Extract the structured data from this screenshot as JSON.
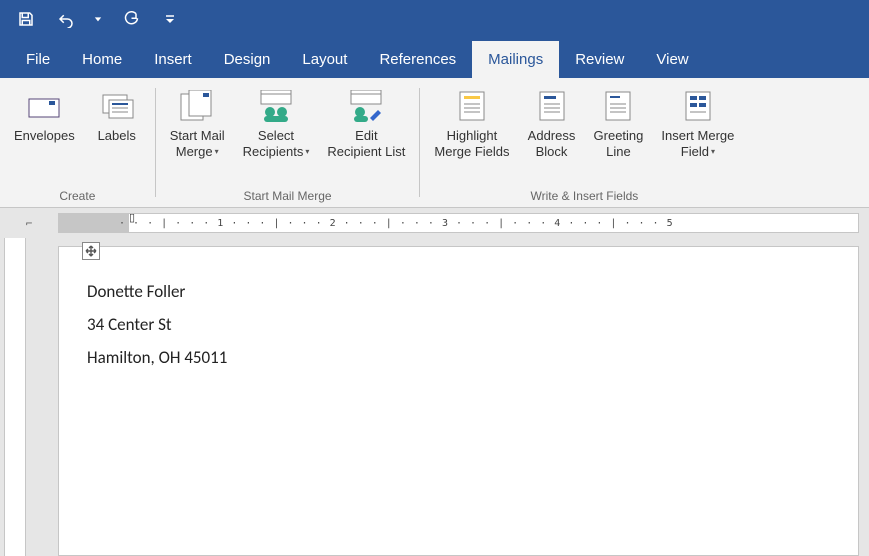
{
  "qat": {
    "save": "save-icon",
    "undo": "undo-icon",
    "redo": "redo-icon",
    "customize": "customize-icon"
  },
  "tabs": {
    "file": "File",
    "home": "Home",
    "insert": "Insert",
    "design": "Design",
    "layout": "Layout",
    "references": "References",
    "mailings": "Mailings",
    "review": "Review",
    "view": "View"
  },
  "ribbon": {
    "create": {
      "envelopes": "Envelopes",
      "labels": "Labels",
      "group_label": "Create"
    },
    "startmm": {
      "start_l1": "Start Mail",
      "start_l2": "Merge",
      "select_l1": "Select",
      "select_l2": "Recipients",
      "edit_l1": "Edit",
      "edit_l2": "Recipient List",
      "group_label": "Start Mail Merge"
    },
    "write": {
      "hl_l1": "Highlight",
      "hl_l2": "Merge Fields",
      "ab_l1": "Address",
      "ab_l2": "Block",
      "gl_l1": "Greeting",
      "gl_l2": "Line",
      "im_l1": "Insert Merge",
      "im_l2": "Field",
      "group_label": "Write & Insert Fields"
    }
  },
  "ruler": {
    "corner": "⌐",
    "ticks": "· · · | · · · 1 · · · | · · · 2 · · · | · · · 3 · · · | · · · 4 · · · | · · · 5"
  },
  "document": {
    "line1": "Donette Foller",
    "line2": "34 Center St",
    "line3": "Hamilton, OH 45011"
  }
}
